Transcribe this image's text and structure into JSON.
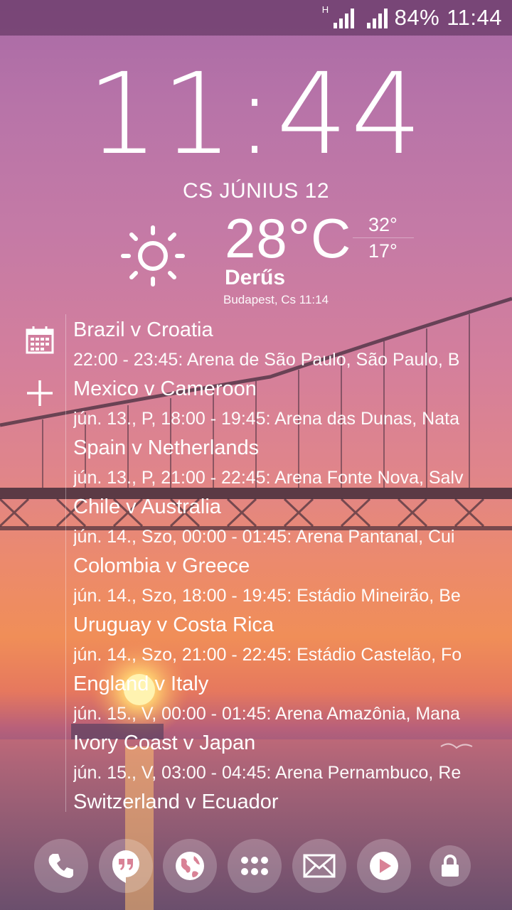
{
  "status_bar": {
    "network_type": "H",
    "battery": "84%",
    "time": "11:44"
  },
  "clock": {
    "time": "11:44",
    "date": "CS JÚNIUS 12"
  },
  "weather": {
    "icon": "sun-icon",
    "temperature": "28°C",
    "high": "32°",
    "low": "17°",
    "condition": "Derűs",
    "location_time": "Budapest, Cs 11:14"
  },
  "sidebar": {
    "calendar_icon": "calendar-icon",
    "add_icon": "plus-icon"
  },
  "events": [
    {
      "title": "Brazil v Croatia",
      "details": "22:00 - 23:45: Arena de São Paulo, São Paulo, B"
    },
    {
      "title": "Mexico v Cameroon",
      "details": "jún. 13., P, 18:00 - 19:45: Arena das Dunas, Nata"
    },
    {
      "title": "Spain v Netherlands",
      "details": "jún. 13., P, 21:00 - 22:45: Arena Fonte Nova, Salv"
    },
    {
      "title": "Chile v Australia",
      "details": "jún. 14., Szo, 00:00 - 01:45: Arena Pantanal, Cui"
    },
    {
      "title": "Colombia v Greece",
      "details": "jún. 14., Szo, 18:00 - 19:45: Estádio Mineirão, Be"
    },
    {
      "title": "Uruguay v Costa Rica",
      "details": "jún. 14., Szo, 21:00 - 22:45: Estádio Castelão, Fo"
    },
    {
      "title": "England v Italy",
      "details": "jún. 15., V, 00:00 - 01:45: Arena Amazônia, Mana"
    },
    {
      "title": "Ivory Coast v Japan",
      "details": "jún. 15., V, 03:00 - 04:45: Arena Pernambuco, Re"
    },
    {
      "title": "Switzerland v Ecuador",
      "details": ""
    }
  ],
  "dock": [
    "phone-icon",
    "hangouts-icon",
    "browser-globe-icon",
    "app-drawer-icon",
    "email-icon",
    "play-store-icon",
    "lock-icon"
  ],
  "colors": {
    "sky_top": "#a86aa6",
    "sunset": "#f08e58",
    "water": "#6e5270"
  }
}
